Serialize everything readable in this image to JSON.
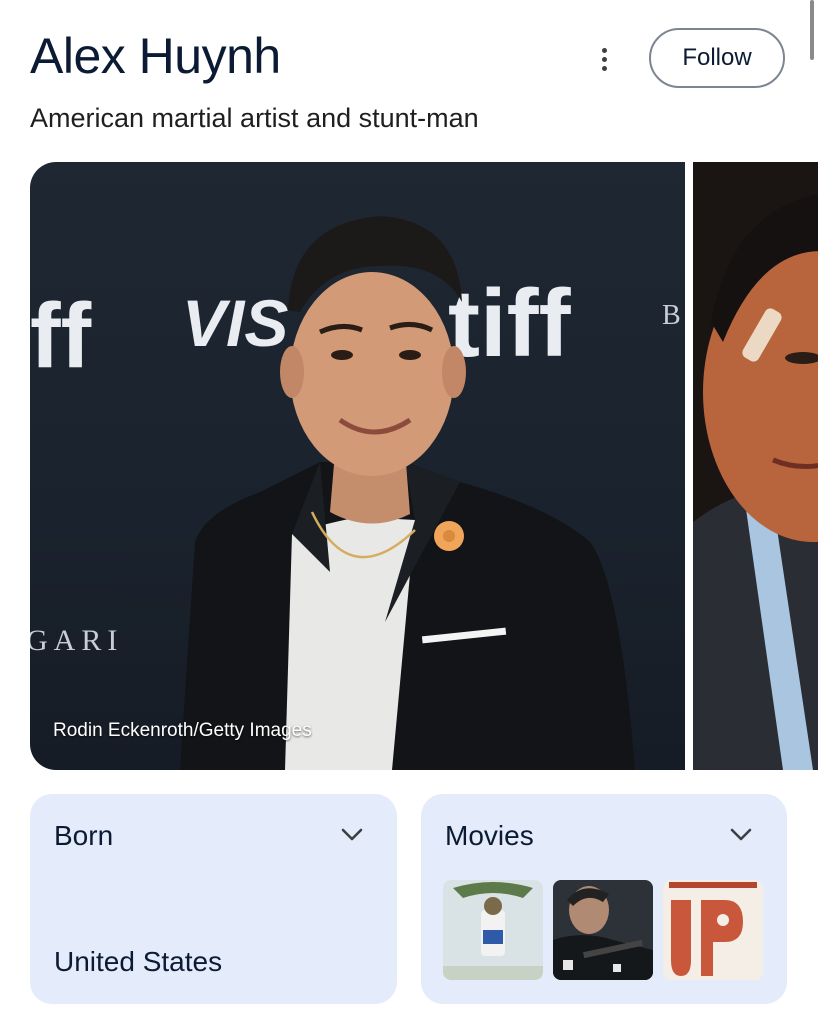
{
  "header": {
    "title": "Alex Huynh",
    "subtitle": "American martial artist and stunt-man",
    "follow_label": "Follow"
  },
  "gallery": {
    "credit": "Rodin Eckenroth/Getty Images",
    "backdrop_texts": [
      "ff",
      "VIS",
      "tiff",
      "B",
      "GARI"
    ]
  },
  "cards": {
    "born": {
      "title": "Born",
      "value": "United States"
    },
    "movies": {
      "title": "Movies"
    }
  },
  "colors": {
    "card_bg": "#e4ecfb",
    "title_text": "#0b1b33",
    "backdrop": "#1f2733"
  },
  "icons": [
    "more-vert-icon",
    "chevron-down-icon"
  ]
}
